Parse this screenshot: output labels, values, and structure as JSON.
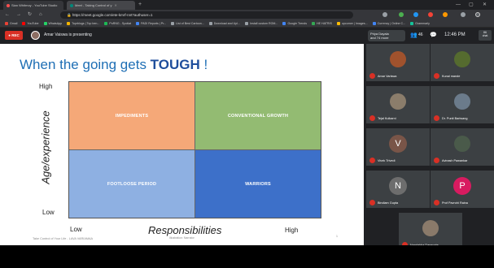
{
  "browser": {
    "tab_title": "Sian Whitmoy - YouTube Studio",
    "tab2_title": "Meet - Taking Control of y",
    "url": "https://meet.google.com/ete-kmrf-nnt?authuser=1",
    "bookmarks": [
      "Gmail",
      "YouTube",
      "WhatsApp",
      "Toprblogs | Top ben...",
      "PoRNG - Spotiat",
      "PADI Reports | Pr...",
      "List of Best Cartoon...",
      "Download and Upl...",
      "Install custom ROM...",
      "Google Trends",
      "HE HATRIS",
      "upcomer | Images...",
      "Currency | Online C...",
      "Grammarly"
    ],
    "colors": {
      "tab_dot": "#ff4f4f",
      "ext1": "#4caf50",
      "ext2": "#2196f3",
      "ext3": "#f44336",
      "ext4": "#ff9800"
    }
  },
  "meet": {
    "rec_label": "REC",
    "presenting_text": "Amar Vaiswa is presenting",
    "chip1": "Priya Dayala",
    "chip1_sub": "and 74 more",
    "chip2": "46",
    "time": "12:46 PM",
    "badge_line1": "86",
    "badge_line2": "chat"
  },
  "slide": {
    "title_prefix": "When the going gets ",
    "title_bold": "TOUGH",
    "title_suffix": " !",
    "quadrants": {
      "top_left": "IMPEDIMENTS",
      "top_right": "CONVENTIONAL GROWTH",
      "bottom_left": "FOOTLOOSE PERIOD",
      "bottom_right": "WARRIORS"
    },
    "y_axis_label": "Age/experience",
    "y_high": "High",
    "y_low": "Low",
    "x_axis_label": "Responsibilities",
    "x_low": "Low",
    "x_high": "High",
    "footer_left": "Take Control of Your Life - LAVA VARIAMAA",
    "footer_mid": "Illustration: Narrator",
    "page_number": "1",
    "colors": {
      "top_left": "#f5a878",
      "top_right": "#93bb72",
      "bottom_left": "#8eb0e2",
      "bottom_right": "#3d70c9",
      "title": "#1f6fb5"
    }
  },
  "participants": [
    {
      "name": "Amar Variswa",
      "initial": "",
      "color": "#a0522d"
    },
    {
      "name": "Kunal mande",
      "initial": "",
      "color": "#556b2f"
    },
    {
      "name": "Tejal Kulkarni",
      "initial": "",
      "color": "#8b7d6b"
    },
    {
      "name": "Dr. Punit Bariwang",
      "initial": "",
      "color": "#6b7b8b"
    },
    {
      "name": "Vivek Trivedi",
      "initial": "V",
      "color": "#795548"
    },
    {
      "name": "Avinash Pawankar",
      "initial": "",
      "color": "#4a5a4a"
    },
    {
      "name": "Bindiam Gupta",
      "initial": "N",
      "color": "#6d6d6d"
    },
    {
      "name": "Prof Pavrohi Raina",
      "initial": "P",
      "color": "#d81b60"
    },
    {
      "name": "Nandakha Dasgupta",
      "initial": "",
      "color": "#8a7a6a"
    }
  ]
}
